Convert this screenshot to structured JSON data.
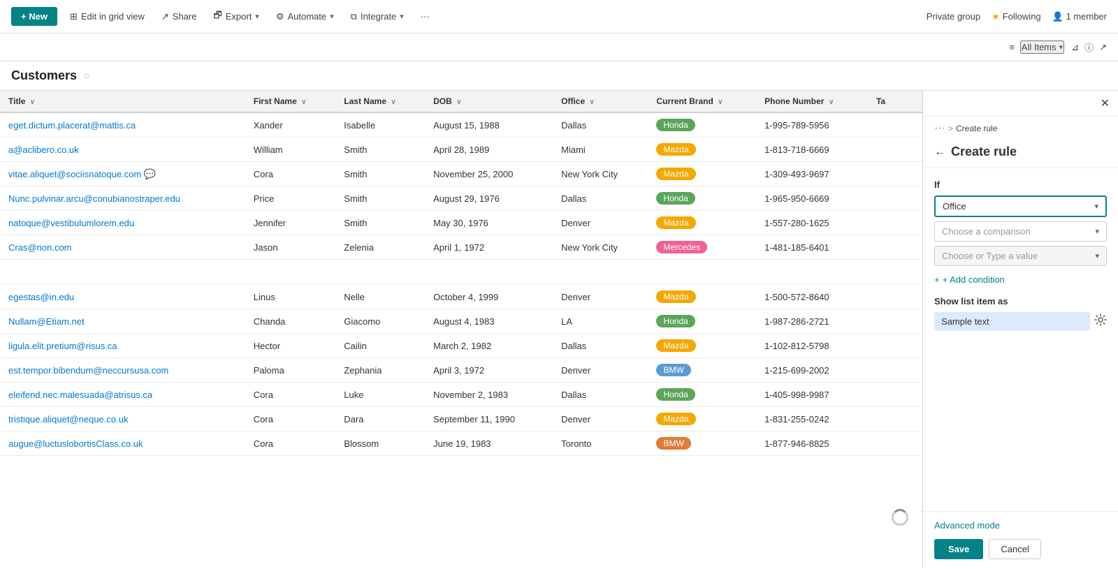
{
  "topbar": {
    "new_label": "+ New",
    "edit_grid_label": "Edit in grid view",
    "share_label": "Share",
    "export_label": "Export",
    "automate_label": "Automate",
    "integrate_label": "Integrate",
    "more_label": "···",
    "private_group_label": "Private group",
    "following_label": "Following",
    "member_label": "1 member",
    "all_items_label": "All Items"
  },
  "page": {
    "title": "Customers",
    "star_icon": "☆"
  },
  "table": {
    "columns": [
      {
        "id": "title",
        "label": "Title"
      },
      {
        "id": "first_name",
        "label": "First Name"
      },
      {
        "id": "last_name",
        "label": "Last Name"
      },
      {
        "id": "dob",
        "label": "DOB"
      },
      {
        "id": "office",
        "label": "Office"
      },
      {
        "id": "current_brand",
        "label": "Current Brand"
      },
      {
        "id": "phone_number",
        "label": "Phone Number"
      },
      {
        "id": "ta",
        "label": "Ta"
      }
    ],
    "rows": [
      {
        "title": "eget.dictum.placerat@mattis.ca",
        "first_name": "Xander",
        "last_name": "Isabelle",
        "dob": "August 15, 1988",
        "office": "Dallas",
        "brand": "Honda",
        "brand_class": "badge-honda",
        "phone": "1-995-789-5956",
        "has_chat": false
      },
      {
        "title": "a@aclibero.co.uk",
        "first_name": "William",
        "last_name": "Smith",
        "dob": "April 28, 1989",
        "office": "Miami",
        "brand": "Mazda",
        "brand_class": "badge-mazda",
        "phone": "1-813-718-6669",
        "has_chat": false
      },
      {
        "title": "vitae.aliquet@sociisnatoque.com",
        "first_name": "Cora",
        "last_name": "Smith",
        "dob": "November 25, 2000",
        "office": "New York City",
        "brand": "Mazda",
        "brand_class": "badge-mazda",
        "phone": "1-309-493-9697",
        "has_chat": true
      },
      {
        "title": "Nunc.pulvinar.arcu@conubianostraper.edu",
        "first_name": "Price",
        "last_name": "Smith",
        "dob": "August 29, 1976",
        "office": "Dallas",
        "brand": "Honda",
        "brand_class": "badge-honda",
        "phone": "1-965-950-6669",
        "has_chat": false
      },
      {
        "title": "natoque@vestibulumlorem.edu",
        "first_name": "Jennifer",
        "last_name": "Smith",
        "dob": "May 30, 1976",
        "office": "Denver",
        "brand": "Mazda",
        "brand_class": "badge-mazda",
        "phone": "1-557-280-1625",
        "has_chat": false
      },
      {
        "title": "Cras@non.com",
        "first_name": "Jason",
        "last_name": "Zelenia",
        "dob": "April 1, 1972",
        "office": "New York City",
        "brand": "Mercedes",
        "brand_class": "badge-mercedes",
        "phone": "1-481-185-6401",
        "has_chat": false
      },
      {
        "title": "",
        "first_name": "",
        "last_name": "",
        "dob": "",
        "office": "",
        "brand": "",
        "brand_class": "",
        "phone": "",
        "has_chat": false,
        "empty": true
      },
      {
        "title": "egestas@in.edu",
        "first_name": "Linus",
        "last_name": "Nelle",
        "dob": "October 4, 1999",
        "office": "Denver",
        "brand": "Mazda",
        "brand_class": "badge-mazda",
        "phone": "1-500-572-8640",
        "has_chat": false
      },
      {
        "title": "Nullam@Etiam.net",
        "first_name": "Chanda",
        "last_name": "Giacomo",
        "dob": "August 4, 1983",
        "office": "LA",
        "brand": "Honda",
        "brand_class": "badge-honda",
        "phone": "1-987-286-2721",
        "has_chat": false
      },
      {
        "title": "ligula.elit.pretium@risus.ca",
        "first_name": "Hector",
        "last_name": "Cailin",
        "dob": "March 2, 1982",
        "office": "Dallas",
        "brand": "Mazda",
        "brand_class": "badge-mazda",
        "phone": "1-102-812-5798",
        "has_chat": false
      },
      {
        "title": "est.tempor.bibendum@neccursusa.com",
        "first_name": "Paloma",
        "last_name": "Zephania",
        "dob": "April 3, 1972",
        "office": "Denver",
        "brand": "BMW",
        "brand_class": "badge-bmw",
        "phone": "1-215-699-2002",
        "has_chat": false
      },
      {
        "title": "eleifend.nec.malesuada@atrisus.ca",
        "first_name": "Cora",
        "last_name": "Luke",
        "dob": "November 2, 1983",
        "office": "Dallas",
        "brand": "Honda",
        "brand_class": "badge-honda",
        "phone": "1-405-998-9987",
        "has_chat": false
      },
      {
        "title": "tristique.aliquet@neque.co.uk",
        "first_name": "Cora",
        "last_name": "Dara",
        "dob": "September 11, 1990",
        "office": "Denver",
        "brand": "Mazda",
        "brand_class": "badge-mazda",
        "phone": "1-831-255-0242",
        "has_chat": false
      },
      {
        "title": "augue@luctuslobortisClass.co.uk",
        "first_name": "Cora",
        "last_name": "Blossom",
        "dob": "June 19, 1983",
        "office": "Toronto",
        "brand": "BMW",
        "brand_class": "badge-bmw-orange",
        "phone": "1-877-946-8825",
        "has_chat": false
      }
    ]
  },
  "panel": {
    "close_icon": "✕",
    "breadcrumb_dots": "···",
    "breadcrumb_arrow": ">",
    "breadcrumb_current": "Create rule",
    "back_icon": "←",
    "title": "Create rule",
    "if_label": "If",
    "field_value": "Office",
    "comparison_placeholder": "Choose a comparison",
    "value_placeholder": "Choose or Type a value",
    "add_condition_label": "+ Add condition",
    "show_as_label": "Show list item as",
    "sample_text": "Sample text",
    "format_icon": "⚙",
    "advanced_mode_label": "Advanced mode",
    "save_label": "Save",
    "cancel_label": "Cancel"
  },
  "colors": {
    "teal": "#038387",
    "honda_green": "#5ba55b",
    "mazda_yellow": "#f4a800",
    "mercedes_pink": "#f06292",
    "bmw_blue": "#5b9bd5",
    "bmw_orange": "#e07b39"
  }
}
